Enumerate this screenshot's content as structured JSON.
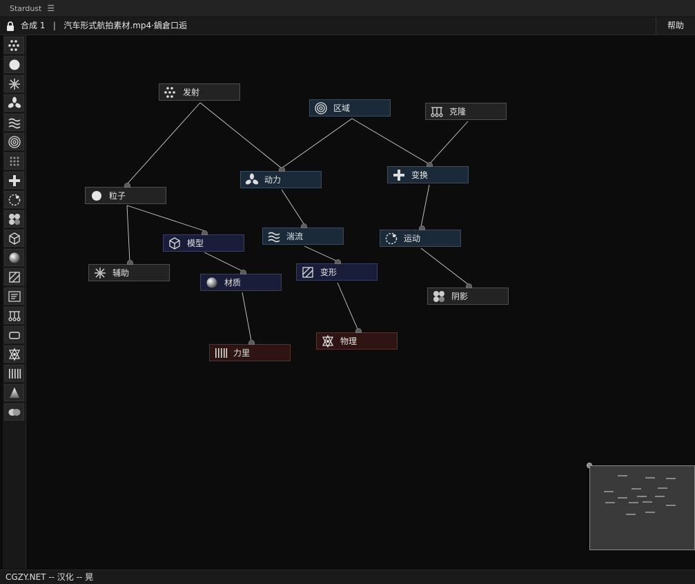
{
  "window": {
    "tab_title": "Stardust",
    "menu_icon": "hamburger-icon"
  },
  "topbar": {
    "lock_icon": "lock-icon",
    "composition": "合成 1",
    "separator": "|",
    "layer": "汽车形式航拍素材.mp4·鍋倉口逅",
    "help_label": "帮助"
  },
  "toolbar": {
    "tools": [
      "emitter-icon",
      "particle-icon",
      "auxiliary-icon",
      "force-icon",
      "turbulence-icon",
      "field-icon",
      "replicator-icon",
      "transform-icon",
      "motion-icon",
      "shadow-icon",
      "model-icon",
      "material-icon",
      "deform-icon",
      "text-icon",
      "clone-icon",
      "shape-icon",
      "physics-icon",
      "force-bar-icon",
      "light-icon",
      "merge-icon"
    ]
  },
  "nodes": {
    "emit": {
      "label": "发射",
      "icon": "emitter-icon",
      "color": "#232323"
    },
    "field": {
      "label": "区域",
      "icon": "field-icon",
      "color": "#1a2a38"
    },
    "clone": {
      "label": "克隆",
      "icon": "clone-icon",
      "color": "#232323"
    },
    "force": {
      "label": "动力",
      "icon": "force-icon",
      "color": "#1a2a38"
    },
    "transform": {
      "label": "变换",
      "icon": "transform-icon",
      "color": "#1a2a38"
    },
    "particle": {
      "label": "粒子",
      "icon": "particle-icon",
      "color": "#232323"
    },
    "model": {
      "label": "模型",
      "icon": "model-icon",
      "color": "#1a1d3a"
    },
    "turbulence": {
      "label": "湍流",
      "icon": "turbulence-icon",
      "color": "#1a2a38"
    },
    "motion": {
      "label": "运动",
      "icon": "motion-icon",
      "color": "#1a2a38"
    },
    "auxiliary": {
      "label": "辅助",
      "icon": "auxiliary-icon",
      "color": "#232323"
    },
    "material": {
      "label": "材质",
      "icon": "material-icon",
      "color": "#1a1d3a"
    },
    "deform": {
      "label": "变形",
      "icon": "deform-icon",
      "color": "#1a1d3a"
    },
    "shadow": {
      "label": "阴影",
      "icon": "shadow-icon",
      "color": "#232323"
    },
    "forcebar": {
      "label": "力里",
      "icon": "force-bar-icon",
      "color": "#2e1513"
    },
    "physics": {
      "label": "物理",
      "icon": "physics-icon",
      "color": "#2e1513"
    }
  },
  "statusbar": {
    "text": "CGZY.NET -- 汉化 -- 晃"
  }
}
